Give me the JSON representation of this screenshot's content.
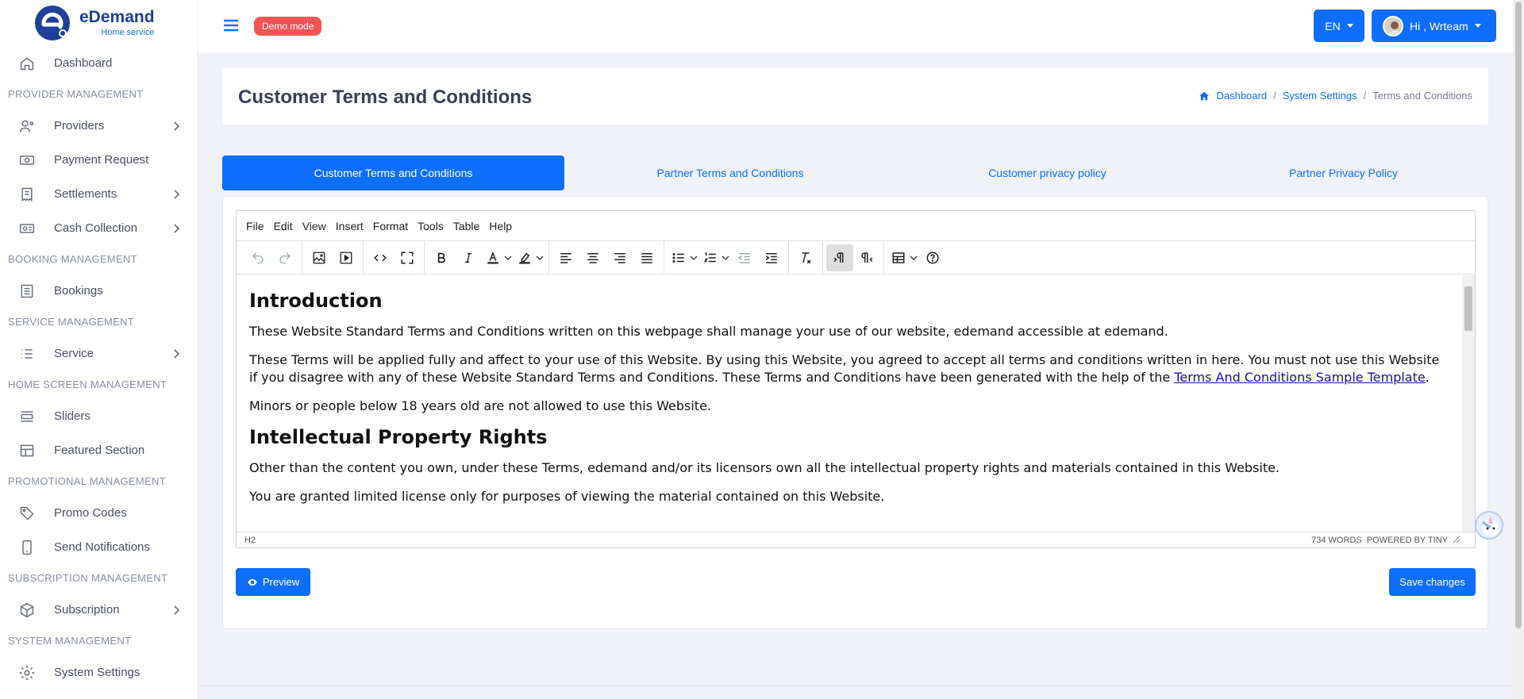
{
  "brand": {
    "name": "eDemand",
    "tagline": "Home service"
  },
  "topbar": {
    "demo_badge": "Demo mode",
    "language": "EN",
    "user_greeting": "Hi , Wrteam"
  },
  "sidebar": {
    "dashboard": "Dashboard",
    "sections": {
      "provider": "PROVIDER MANAGEMENT",
      "booking": "BOOKING MANAGEMENT",
      "service": "SERVICE MANAGEMENT",
      "home_screen": "HOME SCREEN MANAGEMENT",
      "promotional": "PROMOTIONAL MANAGEMENT",
      "subscription": "SUBSCRIPTION MANAGEMENT",
      "system": "SYSTEM MANAGEMENT"
    },
    "items": {
      "providers": "Providers",
      "payment_request": "Payment Request",
      "settlements": "Settlements",
      "cash_collection": "Cash Collection",
      "bookings": "Bookings",
      "service": "Service",
      "sliders": "Sliders",
      "featured_section": "Featured Section",
      "promo_codes": "Promo Codes",
      "send_notifications": "Send Notifications",
      "subscription": "Subscription",
      "system_settings": "System Settings"
    }
  },
  "page": {
    "title": "Customer Terms and Conditions",
    "breadcrumb": [
      "Dashboard",
      "System Settings",
      "Terms and Conditions"
    ],
    "breadcrumb_sep": "/"
  },
  "tabs": [
    "Customer Terms and Conditions",
    "Partner Terms and Conditions",
    "Customer privacy policy",
    "Partner Privacy Policy"
  ],
  "editor": {
    "menu": [
      "File",
      "Edit",
      "View",
      "Insert",
      "Format",
      "Tools",
      "Table",
      "Help"
    ],
    "content": {
      "h1": "Introduction",
      "p1": "These Website Standard Terms and Conditions written on this webpage shall manage your use of our website, edemand accessible at edemand.",
      "p2_before": "These Terms will be applied fully and affect to your use of this Website. By using this Website, you agreed to accept all terms and conditions written in here. You must not use this Website if you disagree with any of these Website Standard Terms and Conditions. These Terms and Conditions have been generated with the help of the ",
      "p2_link": "Terms And Conditions Sample Template",
      "p2_after": ".",
      "p3": "Minors or people below 18 years old are not allowed to use this Website.",
      "h2": "Intellectual Property Rights",
      "p4": "Other than the content you own, under these Terms, edemand and/or its licensors own all the intellectual property rights and materials contained in this Website.",
      "p5": "You are granted limited license only for purposes of viewing the material contained on this Website."
    },
    "status_path": "H2",
    "word_count": "734 WORDS",
    "powered_by": "POWERED BY TINY"
  },
  "actions": {
    "preview": "Preview",
    "save": "Save changes"
  },
  "colors": {
    "primary": "#0d6efd",
    "demo_badge": "#f25454",
    "brand": "#1e3f9a"
  }
}
